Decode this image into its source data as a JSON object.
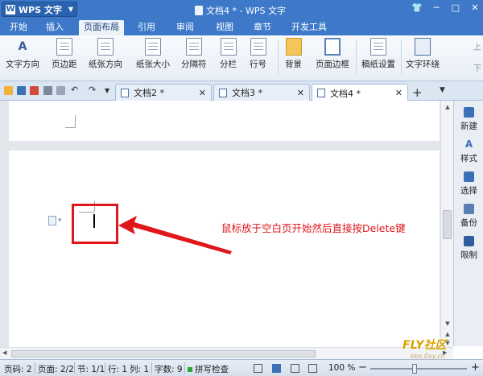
{
  "app": {
    "name": "WPS 文字",
    "window_title": "文档4 * - WPS 文字"
  },
  "menu": {
    "tabs": [
      "开始",
      "插入",
      "页面布局",
      "引用",
      "审阅",
      "视图",
      "章节",
      "开发工具"
    ],
    "active": "页面布局"
  },
  "ribbon": {
    "buttons": [
      "文字方向",
      "页边距",
      "纸张方向",
      "纸张大小",
      "分隔符",
      "分栏",
      "行号",
      "背景",
      "页面边框",
      "稿纸设置",
      "文字环绕"
    ],
    "right": [
      "上",
      "下"
    ]
  },
  "tabs": [
    {
      "label": "文档2 *"
    },
    {
      "label": "文档3 *"
    },
    {
      "label": "文档4 *",
      "active": true
    }
  ],
  "right_panel": [
    "新建",
    "样式",
    "选择",
    "备份",
    "限制"
  ],
  "annotation": {
    "text": "鼠标放于空白页开始然后直接按Delete键",
    "color": "#e0161b"
  },
  "status": {
    "page_no": "页码: 2",
    "page": "页面: 2/2",
    "section": "节: 1/1",
    "row": "行: 1",
    "col": "列: 1",
    "chars": "字数: 9",
    "spell": "拼写检查",
    "zoom": "100 %"
  },
  "watermark": {
    "brand": "FLY社区",
    "url": "bbs.0xy.cn"
  },
  "colors": {
    "accent": "#3d79c8",
    "annotation": "#e0161b"
  }
}
